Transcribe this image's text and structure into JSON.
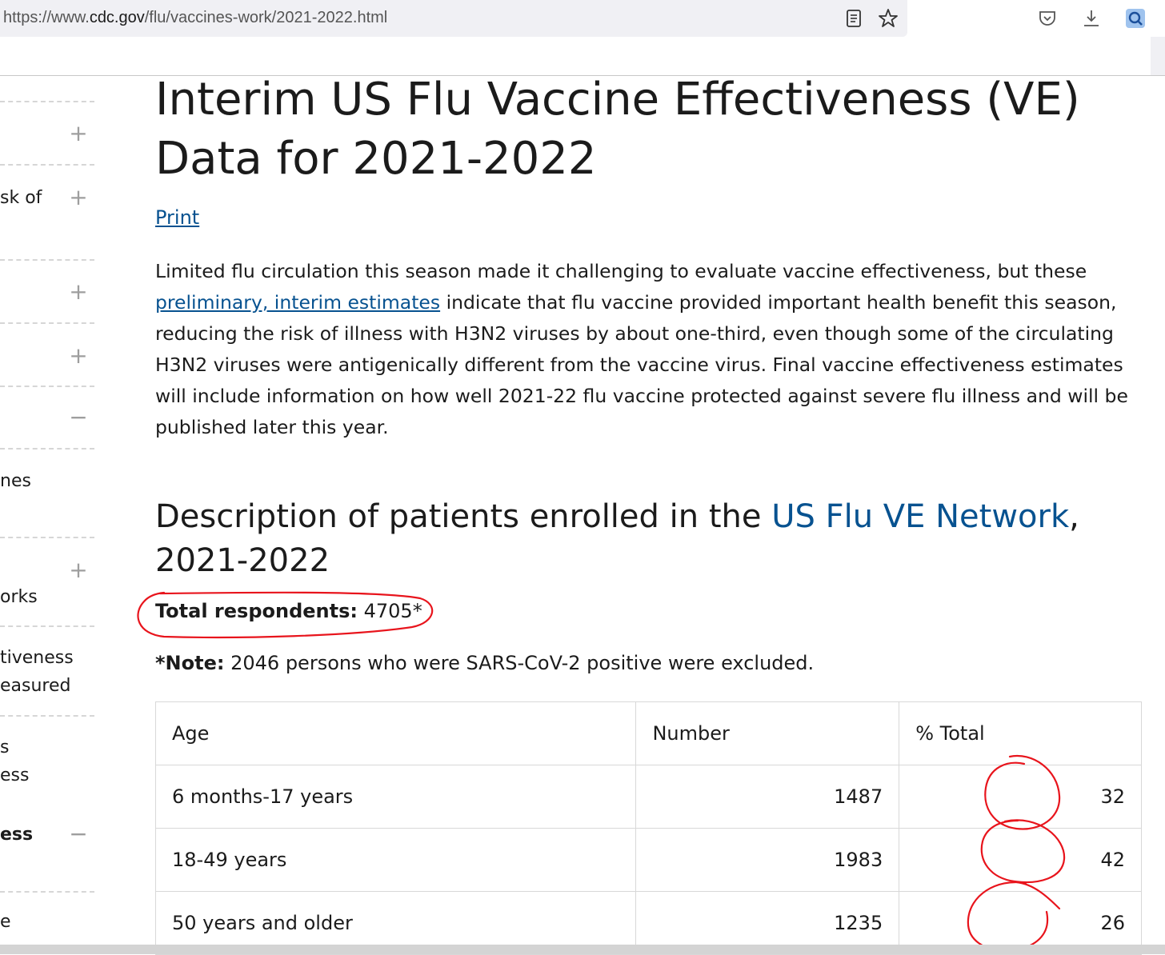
{
  "browser": {
    "url_prefix": "https://www.",
    "url_host": "cdc.gov",
    "url_path": "/flu/vaccines-work/2021-2022.html",
    "icons": [
      "reader-view-icon",
      "bookmark-star-icon",
      "pocket-icon",
      "download-icon",
      "extension-icon"
    ]
  },
  "leftnav": {
    "texts": [
      "sk of",
      "nes",
      "orks",
      "tiveness",
      "easured",
      "s",
      "ess",
      "ess",
      "e"
    ],
    "toggles": [
      "+",
      "+",
      "+",
      "+",
      "−",
      "+",
      "−"
    ]
  },
  "page": {
    "title": "Interim US Flu Vaccine Effectiveness (VE) Data for 2021-2022",
    "print_label": "Print",
    "intro_before": "Limited flu circulation this season made it challenging to evaluate vaccine effectiveness, but these ",
    "intro_link": "preliminary, interim estimates",
    "intro_after": " indicate that flu vaccine provided important health benefit this season, reducing the risk of illness with H3N2 viruses by about one-third, even though some of the circulating H3N2 viruses were antigenically different from the vaccine virus. Final vaccine effectiveness estimates will include information on how well 2021-22 flu vaccine protected against severe flu illness and will be published later this year.",
    "section_title_before": "Description of patients enrolled in the ",
    "section_title_link": "US Flu VE Network",
    "section_title_after": ", 2021-2022",
    "respondents_label": "Total respondents:",
    "respondents_value": " 4705*",
    "note_label": "*Note:",
    "note_text": " 2046 persons who were SARS-CoV-2 positive were excluded."
  },
  "table": {
    "headers": {
      "age": "Age",
      "number": "Number",
      "pct": "% Total"
    },
    "rows": [
      {
        "age": "6 months-17 years",
        "number": "1487",
        "pct": "32"
      },
      {
        "age": "18-49 years",
        "number": "1983",
        "pct": "42"
      },
      {
        "age": "50 years and older",
        "number": "1235",
        "pct": "26"
      }
    ]
  },
  "colors": {
    "link": "#075290",
    "annotation": "#e8141c"
  }
}
